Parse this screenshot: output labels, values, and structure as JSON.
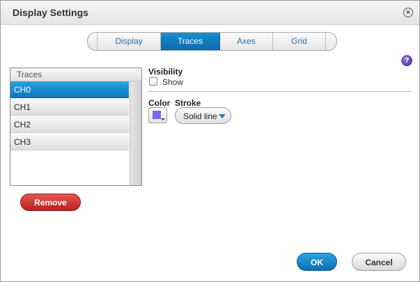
{
  "window": {
    "title": "Display Settings",
    "close_icon": "close-circle-icon"
  },
  "tabs": [
    {
      "label": "Display",
      "active": false
    },
    {
      "label": "Traces",
      "active": true
    },
    {
      "label": "Axes",
      "active": false
    },
    {
      "label": "Grid",
      "active": false
    }
  ],
  "help": {
    "icon": "help-icon",
    "glyph": "?"
  },
  "traces": {
    "header": "Traces",
    "items": [
      "CH0",
      "CH1",
      "CH2",
      "CH3"
    ],
    "selected": "CH0",
    "remove_label": "Remove"
  },
  "visibility": {
    "heading": "Visibility",
    "show_label": "Show",
    "show_checked": false
  },
  "style": {
    "color_label": "Color",
    "color_value": "#7b68ee",
    "stroke_label": "Stroke",
    "stroke_value": "Solid line"
  },
  "footer": {
    "ok_label": "OK",
    "cancel_label": "Cancel"
  },
  "colors": {
    "accent": "#0d77bf",
    "danger": "#c5302a"
  }
}
